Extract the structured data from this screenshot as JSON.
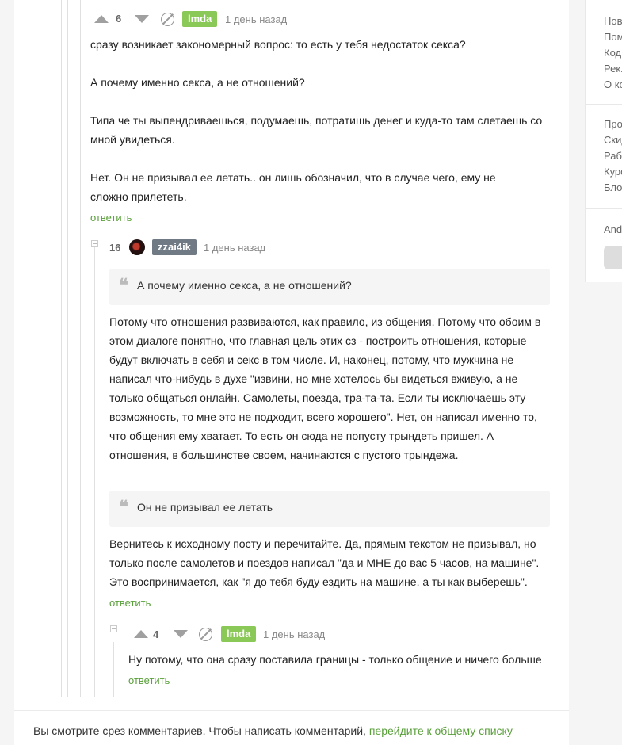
{
  "comments": [
    {
      "rating": "6",
      "author": "lmda",
      "time": "1 день назад",
      "paragraphs": [
        "сразу возникает закономерный вопрос: то есть у тебя недостаток секса?",
        "А почему именно секса, а не отношений?",
        "Типа че ты выпендриваешься, подумаешь, потратишь денег и куда-то там слетаешь со мной увидеться.",
        "Нет. Он не призывал ее летать.. он лишь обозначил, что в случае чего, ему не сложно прилететь."
      ],
      "reply_label": "ответить"
    },
    {
      "rating": "16",
      "author": "zzai4ik",
      "time": "1 день назад",
      "quote1": "А почему именно секса, а не отношений?",
      "body1": "Потому что отношения развиваются, как правило, из общения. Потому что обоим в этом диалоге понятно, что главная цель этих сз - построить отношения, которые будут включать в себя и секс в том числе. И, наконец, потому, что мужчина не написал что-нибудь в духе \"извини, но мне хотелось бы видеться вживую, а не только общаться онлайн. Самолеты, поезда, тра-та-та. Если ты исключаешь эту возможность, то мне это не подходит, всего хорошего\". Нет, он написал именно то, что общения ему хватает. То есть он сюда не попусту трындеть пришел. А отношения, в большинстве своем, начинаются с пустого трындежа.",
      "quote2": "Он не призывал ее летать",
      "body2": "Вернитесь к исходному посту и перечитайте. Да, прямым текстом не призывал, но только после самолетов и поездов написал \"да и МНЕ до вас 5 часов, на машине\". Это воспринимается, как \"я до тебя буду ездить на машине, а ты как выберешь\".",
      "reply_label": "ответить"
    },
    {
      "rating": "4",
      "author": "lmda",
      "time": "1 день назад",
      "body": "Ну потому, что она сразу поставила границы - только общение и ничего больше",
      "reply_label": "ответить"
    }
  ],
  "sidebar": {
    "group1": [
      "Нов",
      "Пом",
      "Код",
      "Рек.",
      "О ко"
    ],
    "group2": [
      "Про",
      "Скид",
      "Раб",
      "Курс",
      "Блог"
    ],
    "group3": [
      "And"
    ]
  },
  "footer": {
    "text": "Вы смотрите срез комментариев. Чтобы написать комментарий,",
    "link": "перейдите к общему списку"
  },
  "colors": {
    "accent_green": "#8ac858",
    "link_green": "#5aa03b",
    "gray_badge": "#6f7a85"
  }
}
